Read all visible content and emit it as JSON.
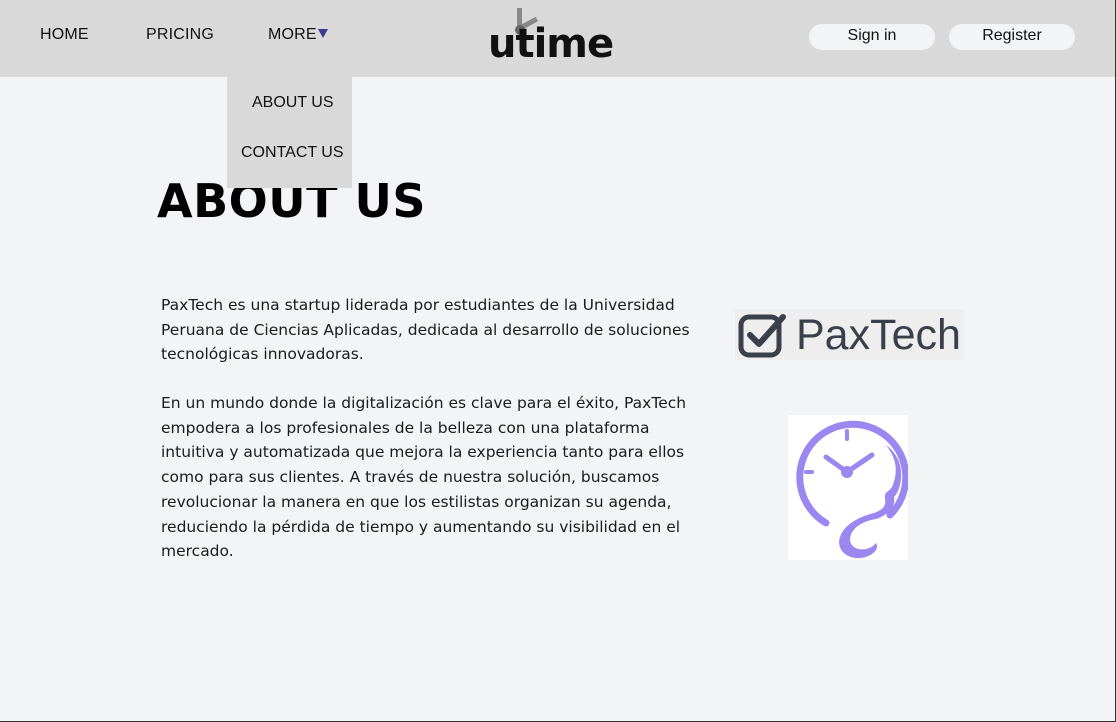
{
  "nav": {
    "home": "HOME",
    "pricing": "PRICING",
    "more": "MORE",
    "brand": "utime",
    "sign_in": "Sign in",
    "register": "Register"
  },
  "dropdown": {
    "items": [
      "ABOUT US",
      "CONTACT US"
    ]
  },
  "page": {
    "title": "ABOUT US",
    "paragraph1": "PaxTech es una startup liderada por estudiantes de la Universidad Peruana de Ciencias Aplicadas, dedicada al desarrollo de soluciones tecnológicas innovadoras.",
    "paragraph2": "En un mundo donde la digitalización es clave para el éxito, PaxTech empodera a los profesionales de la belleza con una plataforma intuitiva y automatizada que mejora la experiencia tanto para ellos como para sus clientes. A través de nuestra solución, buscamos revolucionar la manera en que los estilistas organizan su agenda, reduciendo la pérdida de tiempo y aumentando su visibilidad en el mercado."
  },
  "logos": {
    "paxtech": "PaxTech",
    "paxtech_icon": "checkbox-icon",
    "time_icon": "clock-face-icon"
  },
  "colors": {
    "topbar": "#d9d9d9",
    "background": "#f3f4f6",
    "caret": "#3d3a8c",
    "paxtech_text": "#3a3f4c",
    "time_logo_purple": "#9b87f0"
  }
}
